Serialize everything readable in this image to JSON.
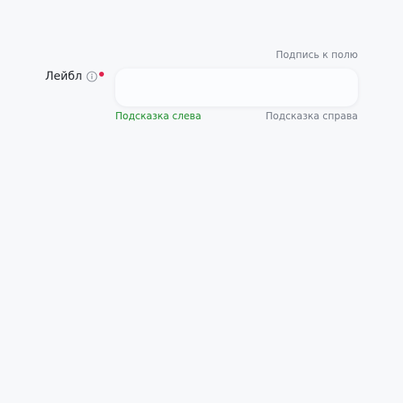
{
  "field": {
    "label": "Лейбл",
    "info_icon": "info-circle-icon",
    "required": true,
    "caption": "Подпись к полю",
    "value": "",
    "placeholder": "",
    "hint_left": "Подсказка слева",
    "hint_right": "Подсказка справа"
  },
  "colors": {
    "background": "#f7f8fa",
    "required_dot": "#e0244e",
    "hint_left": "#1f8f2e",
    "muted_text": "#757b86"
  }
}
